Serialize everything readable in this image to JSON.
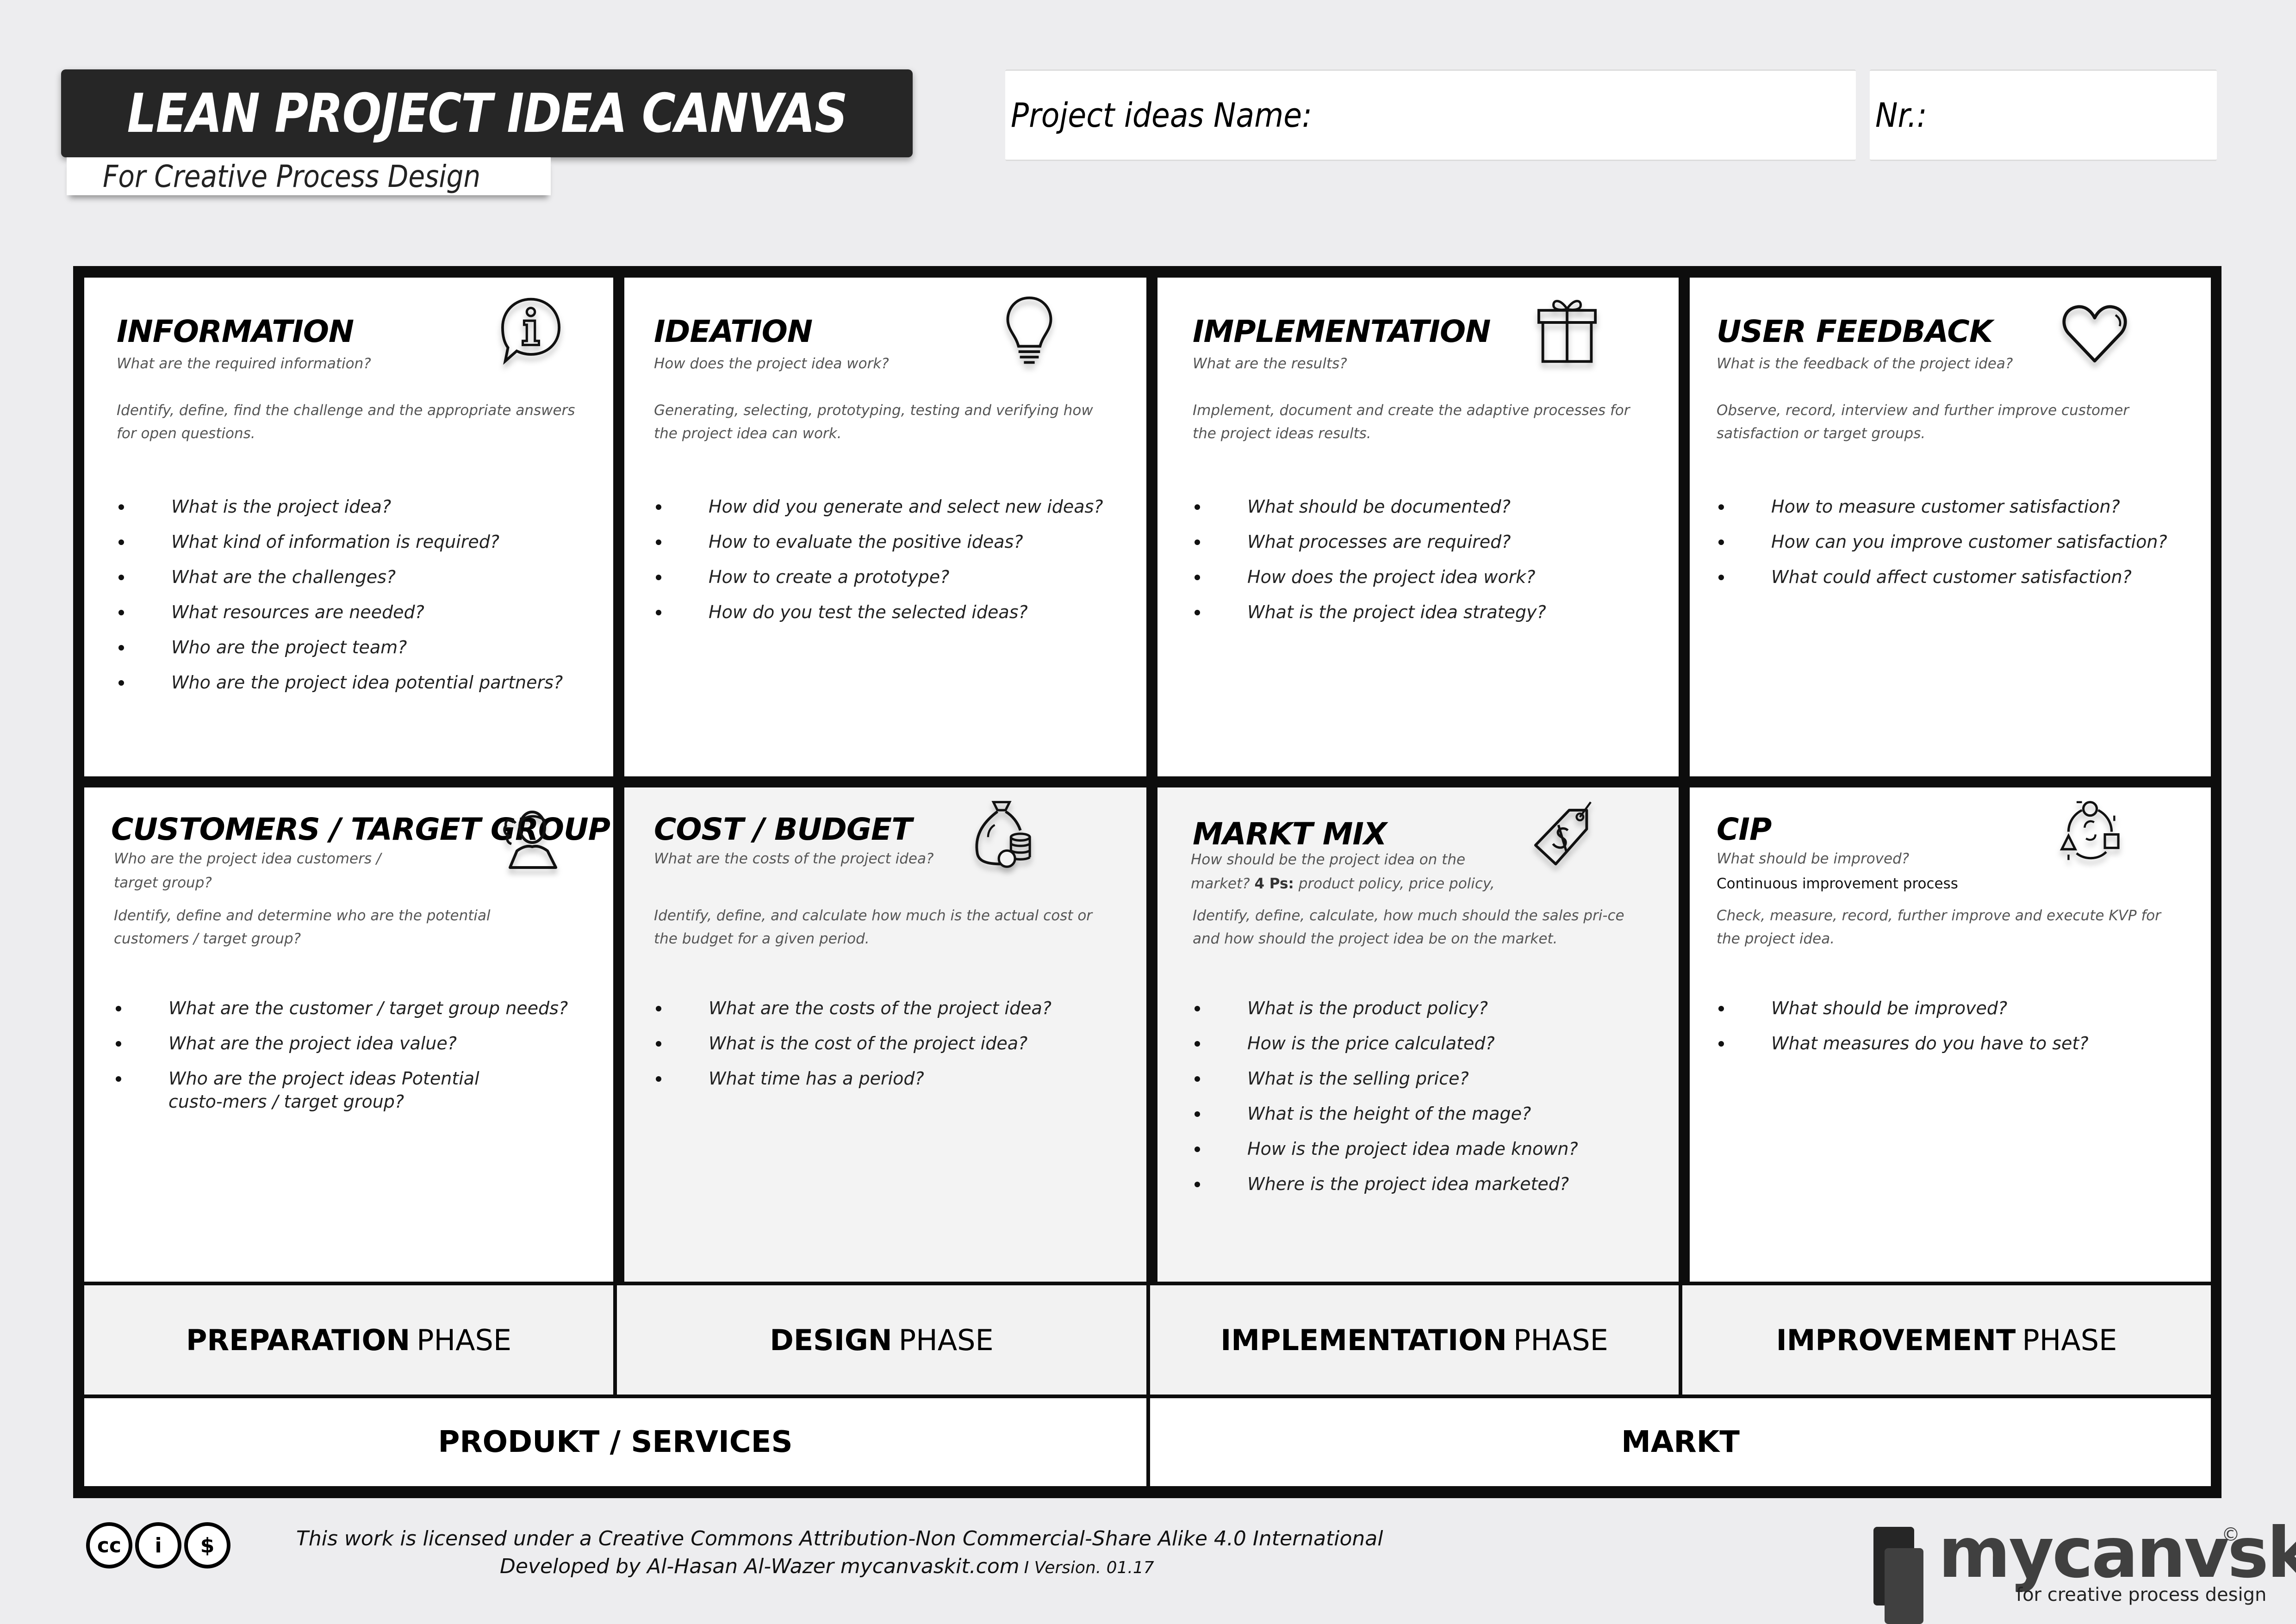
{
  "header": {
    "title": "LEAN PROJECT IDEA CANVAS",
    "subtitle": "For Creative Process Design",
    "name_field_label": "Project ideas Name:",
    "nr_field_label": "Nr.:"
  },
  "cells": [
    {
      "title": "INFORMATION",
      "question": "What are the required information?",
      "description": "Identify, define, find the challenge and the appropriate answers for open questions.",
      "icon": "info-speech-bubble-icon",
      "bullets": [
        "What is the project idea?",
        "What kind of information is required?",
        "What are the challenges?",
        "What resources are needed?",
        "Who are the project team?",
        "Who are the project idea potential partners?"
      ]
    },
    {
      "title": "IDEATION",
      "question": "How does the project idea work?",
      "description": "Generating, selecting, prototyping, testing and verifying how the project idea can work.",
      "icon": "lightbulb-icon",
      "bullets": [
        "How did you generate and select new ideas?",
        "How to evaluate the positive ideas?",
        "How to create a prototype?",
        "How do you test the selected ideas?"
      ]
    },
    {
      "title": "IMPLEMENTATION",
      "question": "What are the results?",
      "description": "Implement, document and create the adaptive processes for the project ideas results.",
      "icon": "gift-icon",
      "bullets": [
        "What should be documented?",
        "What processes are required?",
        "How does the project idea work?",
        "What is the project idea strategy?"
      ]
    },
    {
      "title": "USER FEEDBACK",
      "question": "What is the feedback of the project idea?",
      "description": "Observe, record, interview and further improve customer satisfaction or target groups.",
      "icon": "heart-icon",
      "bullets": [
        "How to measure customer satisfaction?",
        "How can you improve customer satisfaction?",
        "What could affect customer satisfaction?"
      ]
    },
    {
      "title": "CUSTOMERS / TARGET GROUP",
      "question": "Who are the project idea customers / target group?",
      "description": "Identify, define and determine who are the potential customers / target group?",
      "icon": "customers-icon",
      "bullets": [
        "What are the customer / target group needs?",
        "What are the project idea value?",
        "Who are the project ideas Potential custo-mers / target group?"
      ]
    },
    {
      "title": "COST / BUDGET",
      "question": "What are the costs of the project idea?",
      "description": "Identify, define, and calculate how much is the actual cost or the budget for a given period.",
      "icon": "money-bag-icon",
      "bullets": [
        "What are the costs of the project idea?",
        "What is the cost of the project idea?",
        "What time has a period?"
      ]
    },
    {
      "title": "MARKT MIX",
      "question_pre": "How should be the project idea on the market?",
      "question_bold": "4 Ps:",
      "question_post": "product policy, price policy,",
      "description": "Identify, define, calculate, how much should the sales pri-ce and how should the project idea be on the market.",
      "icon": "price-tag-icon",
      "bullets": [
        "What is the product policy?",
        "How is the price calculated?",
        "What is the selling price?",
        "What is the height of the mage?",
        "How is the project idea made known?",
        "Where is the project idea marketed?"
      ]
    },
    {
      "title": "CIP",
      "question": "What should be improved?",
      "question_secondary": "Continuous improvement process",
      "description": "Check, measure, record, further improve and execute KVP for the project idea.",
      "icon": "improvement-cycle-icon",
      "bullets": [
        "What should be improved?",
        "What measures do you have to set?"
      ]
    }
  ],
  "phases": [
    {
      "bold": "PREPARATION",
      "rest": "PHASE"
    },
    {
      "bold": "DESIGN",
      "rest": "PHASE"
    },
    {
      "bold": "IMPLEMENTATION",
      "rest": "PHASE"
    },
    {
      "bold": "IMPROVEMENT",
      "rest": "PHASE"
    }
  ],
  "groups": {
    "left": "PRODUKT / SERVICES",
    "right": "MARKT"
  },
  "footer": {
    "cc_icons": [
      "cc",
      "i",
      "$"
    ],
    "license": "This work is licensed under a Creative Commons Attribution-Non Commercial-Share Alike 4.0 International",
    "developed": "Developed by Al-Hasan Al-Wazer  mycanvaskit.com",
    "version": "I Version. 01.17",
    "logo_word": "mycanvskit",
    "logo_sup": "©",
    "logo_tagline": "for creative process design"
  }
}
